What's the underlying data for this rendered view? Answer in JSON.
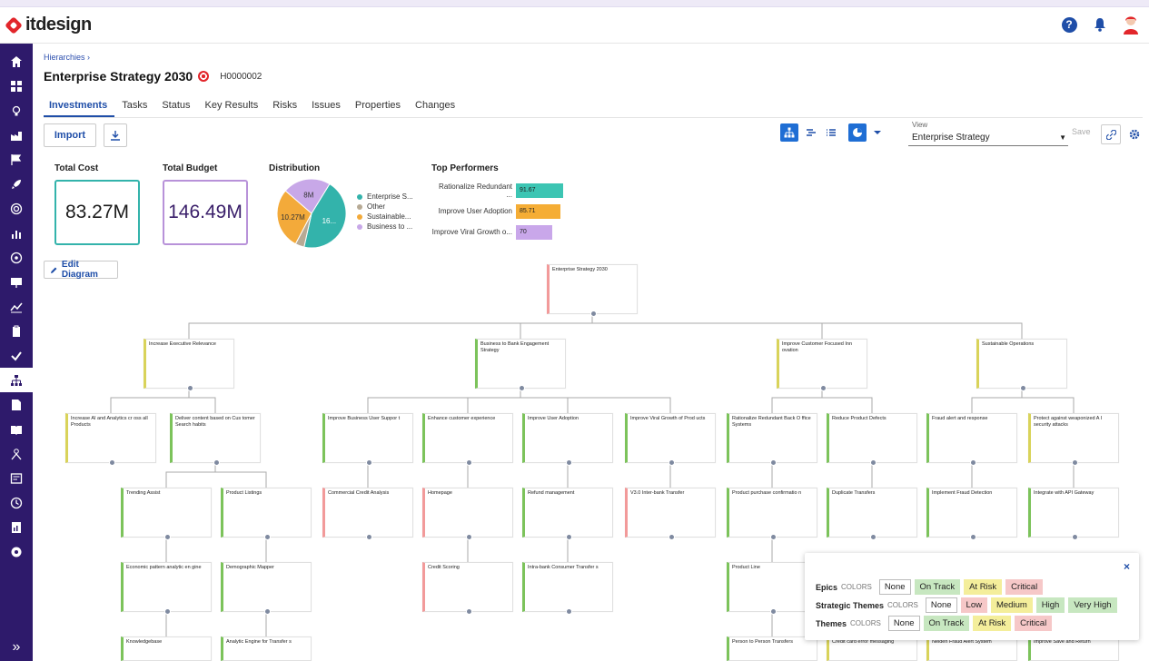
{
  "app": {
    "name": "itdesign"
  },
  "header": {
    "help_icon": "help-icon",
    "bell_icon": "bell-icon",
    "avatar_icon": "user-avatar"
  },
  "breadcrumb": {
    "label": "Hierarchies",
    "separator": "›"
  },
  "page": {
    "title": "Enterprise Strategy 2030",
    "code": "H0000002"
  },
  "tabs": [
    "Investments",
    "Tasks",
    "Status",
    "Key Results",
    "Risks",
    "Issues",
    "Properties",
    "Changes"
  ],
  "toolbar": {
    "import_label": "Import",
    "view_label": "View",
    "view_value": "Enterprise Strategy",
    "save_label": "Save"
  },
  "kpis": {
    "total_cost_label": "Total Cost",
    "total_cost_value": "83.27M",
    "total_budget_label": "Total Budget",
    "total_budget_value": "146.49M",
    "distribution_label": "Distribution",
    "top_performers_label": "Top Performers"
  },
  "distribution": {
    "slices": [
      {
        "label": "Enterprise S...",
        "value": 16.0,
        "display": "16...",
        "color": "#33b3ab"
      },
      {
        "label": "Other",
        "value": 1.5,
        "display": "",
        "color": "#b7aa95"
      },
      {
        "label": "Sustainable...",
        "value": 10.27,
        "display": "10.27M",
        "color": "#f3aa3a"
      },
      {
        "label": "Business to ...",
        "value": 8.0,
        "display": "8M",
        "color": "#c8a8e8"
      }
    ]
  },
  "top_performers": [
    {
      "name": "Rationalize Redundant ...",
      "value": "91.67",
      "pct": 91.67,
      "color": "#3cc5b3"
    },
    {
      "name": "Improve User Adoption",
      "value": "85.71",
      "pct": 85.71,
      "color": "#f5ad35"
    },
    {
      "name": "Improve Viral Growth o...",
      "value": "70",
      "pct": 70,
      "color": "#c9a7ea"
    }
  ],
  "diagram": {
    "edit_label": "Edit Diagram",
    "cards": [
      {
        "id": "root",
        "title": "Enterprise Strategy 2030",
        "color": "#f29a9a"
      },
      {
        "id": "l1a",
        "title": "Increase Executive Relevance",
        "color": "#d9d35a"
      },
      {
        "id": "l1b",
        "title": "Business to Bank Engagement Strategy",
        "color": "#7cc35b"
      },
      {
        "id": "l1c",
        "title": "Improve Customer Focused Inn ovation",
        "color": "#d9d35a"
      },
      {
        "id": "l1d",
        "title": "Sustainable Operations",
        "color": "#d9d35a"
      },
      {
        "id": "l2a",
        "title": "Increase AI and Analytics cr oss all Products",
        "color": "#d9d35a"
      },
      {
        "id": "l2b",
        "title": "Deliver content based on Cus tomer Search habits",
        "color": "#7cc35b"
      },
      {
        "id": "l2c",
        "title": "Improve Business User Suppor t",
        "color": "#7cc35b"
      },
      {
        "id": "l2d",
        "title": "Enhance customer experience",
        "color": "#7cc35b"
      },
      {
        "id": "l2e",
        "title": "Improve User Adoption",
        "color": "#7cc35b"
      },
      {
        "id": "l2f",
        "title": "Improve Viral Growth of Prod ucts",
        "color": "#7cc35b"
      },
      {
        "id": "l2g",
        "title": "Rationalize Redundant Back O ffice Systems",
        "color": "#7cc35b"
      },
      {
        "id": "l2h",
        "title": "Reduce Product Defects",
        "color": "#7cc35b"
      },
      {
        "id": "l2i",
        "title": "Fraud alert and response",
        "color": "#7cc35b"
      },
      {
        "id": "l2j",
        "title": "Protect against weaponized A I security attacks",
        "color": "#d9d35a"
      },
      {
        "id": "l3a",
        "title": "Trending Assist",
        "color": "#7cc35b"
      },
      {
        "id": "l3b",
        "title": "Product Listings",
        "color": "#7cc35b"
      },
      {
        "id": "l3c",
        "title": "Commercial Credit Analysis",
        "color": "#f29a9a"
      },
      {
        "id": "l3d",
        "title": "Homepage",
        "color": "#f29a9a"
      },
      {
        "id": "l3e",
        "title": "Refund management",
        "color": "#7cc35b"
      },
      {
        "id": "l3f",
        "title": "V3.0 Inter-bank Transfer",
        "color": "#f29a9a"
      },
      {
        "id": "l3g",
        "title": "Product purchase confirmatio n",
        "color": "#7cc35b"
      },
      {
        "id": "l3h",
        "title": "Duplicate Transfers",
        "color": "#7cc35b"
      },
      {
        "id": "l3i",
        "title": "Implement Fraud Detection",
        "color": "#7cc35b"
      },
      {
        "id": "l3j",
        "title": "Integrate with API Gateway",
        "color": "#7cc35b"
      },
      {
        "id": "l4a",
        "title": "Economic pattern analytic en gine",
        "color": "#7cc35b"
      },
      {
        "id": "l4b",
        "title": "Demographic Mapper",
        "color": "#7cc35b"
      },
      {
        "id": "l4c",
        "title": "Credit Scoring",
        "color": "#f29a9a"
      },
      {
        "id": "l4d",
        "title": "Intra-bank Consumer Transfer s",
        "color": "#7cc35b"
      },
      {
        "id": "l4e",
        "title": "Product Line",
        "color": "#7cc35b"
      },
      {
        "id": "l5a",
        "title": "Knowledgebase",
        "color": "#7cc35b"
      },
      {
        "id": "l5b",
        "title": "Analytic Engine for Transfer s",
        "color": "#7cc35b"
      },
      {
        "id": "l5c",
        "title": "Person to Person Transfers",
        "color": "#7cc35b"
      },
      {
        "id": "l5d",
        "title": "Credit card error messaging",
        "color": "#d9d35a"
      },
      {
        "id": "l5e",
        "title": "Neiden Fraud Alert System",
        "color": "#d9d35a"
      },
      {
        "id": "l5f",
        "title": "Improve Save and Return",
        "color": "#7cc35b"
      }
    ]
  },
  "colors_popup": {
    "close": "×",
    "rows": [
      {
        "label": "Epics",
        "colors_label": "COLORS",
        "chips": [
          {
            "text": "None",
            "bg": "#ffffff"
          },
          {
            "text": "On Track",
            "bg": "#c7e7c0"
          },
          {
            "text": "At Risk",
            "bg": "#f4ee9b"
          },
          {
            "text": "Critical",
            "bg": "#f6c8c8"
          }
        ]
      },
      {
        "label": "Strategic Themes",
        "colors_label": "COLORS",
        "chips": [
          {
            "text": "None",
            "bg": "#ffffff"
          },
          {
            "text": "Low",
            "bg": "#f6c8c8"
          },
          {
            "text": "Medium",
            "bg": "#f4ee9b"
          },
          {
            "text": "High",
            "bg": "#c7e7c0"
          },
          {
            "text": "Very High",
            "bg": "#c7e7c0"
          }
        ]
      },
      {
        "label": "Themes",
        "colors_label": "COLORS",
        "chips": [
          {
            "text": "None",
            "bg": "#ffffff"
          },
          {
            "text": "On Track",
            "bg": "#c7e7c0"
          },
          {
            "text": "At Risk",
            "bg": "#f4ee9b"
          },
          {
            "text": "Critical",
            "bg": "#f6c8c8"
          }
        ]
      }
    ]
  }
}
